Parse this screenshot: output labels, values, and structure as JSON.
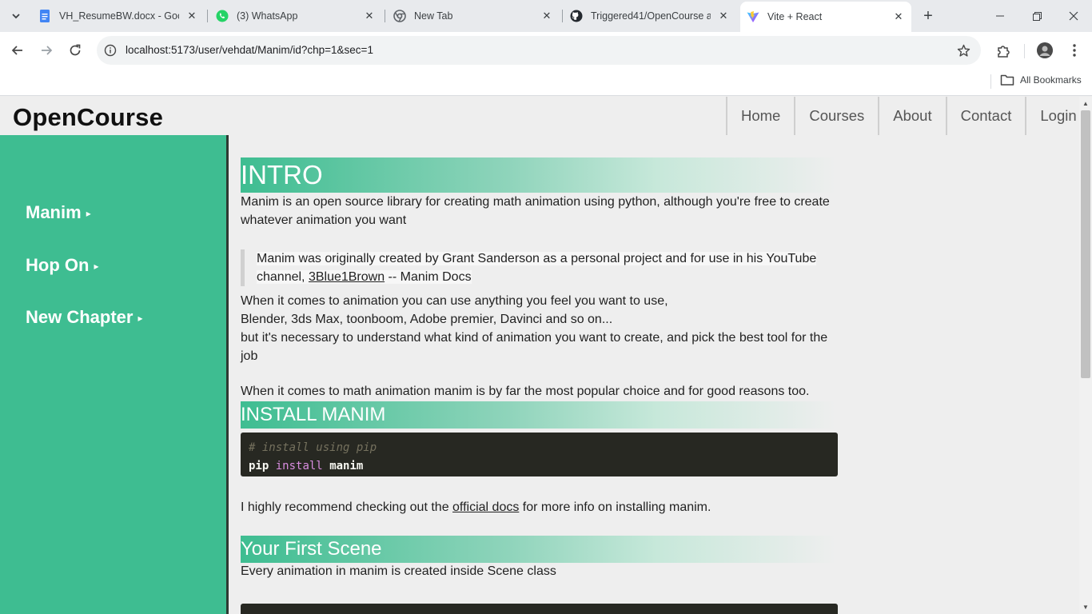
{
  "browser": {
    "tabs": [
      {
        "title": "VH_ResumeBW.docx - Goog",
        "icon": "google-docs-icon"
      },
      {
        "title": "(3) WhatsApp",
        "icon": "whatsapp-icon"
      },
      {
        "title": "New Tab",
        "icon": "chrome-icon"
      },
      {
        "title": "Triggered41/OpenCourse at",
        "icon": "github-icon"
      },
      {
        "title": "Vite + React",
        "icon": "vite-icon"
      }
    ],
    "url": "localhost:5173/user/vehdat/Manim/id?chp=1&sec=1",
    "bookmarks_label": "All Bookmarks",
    "colors": {
      "tabstrip": "#e8eaed",
      "active_tab": "#ffffff"
    }
  },
  "site": {
    "logo": "OpenCourse",
    "nav": [
      "Home",
      "Courses",
      "About",
      "Contact",
      "Login"
    ],
    "sidebar": [
      {
        "label": "Manim",
        "marker": "▸"
      },
      {
        "label": "Hop On",
        "marker": "▸"
      },
      {
        "label": "New Chapter",
        "marker": "▸"
      }
    ],
    "colors": {
      "accent": "#3ebd91",
      "page_bg": "#eeeeee",
      "code_bg": "#272822"
    }
  },
  "content": {
    "intro_heading": "INTRO",
    "intro_para": "Manim is an open source library for creating math animation using python, although you're free to create whatever animation you want",
    "quote_before_link": "Manim was originally created by Grant Sanderson as a personal project and for use in his YouTube channel, ",
    "quote_link": "3Blue1Brown",
    "quote_after_link": " -- Manim Docs",
    "animation_line1": "When it comes to animation you can use anything you feel you want to use,",
    "animation_line2": "Blender, 3ds Max, toonboom, Adobe premier, Davinci and so on...",
    "animation_line3": "but it's necessary to understand what kind of animation you want to create, and pick the best tool for the job",
    "popular_para": "When it comes to math animation manim is by far the most popular choice and for good reasons too.",
    "install_heading": "INSTALL MANIM",
    "code_comment": "# install using pip",
    "code_cmd": "pip",
    "code_kw": "install",
    "code_arg": "manim",
    "recommend_before": "I highly recommend checking out the ",
    "recommend_link": "official docs",
    "recommend_after": " for more info on installing manim.",
    "first_scene_heading": "Your First Scene",
    "first_scene_para": "Every animation in manim is created inside Scene class"
  }
}
